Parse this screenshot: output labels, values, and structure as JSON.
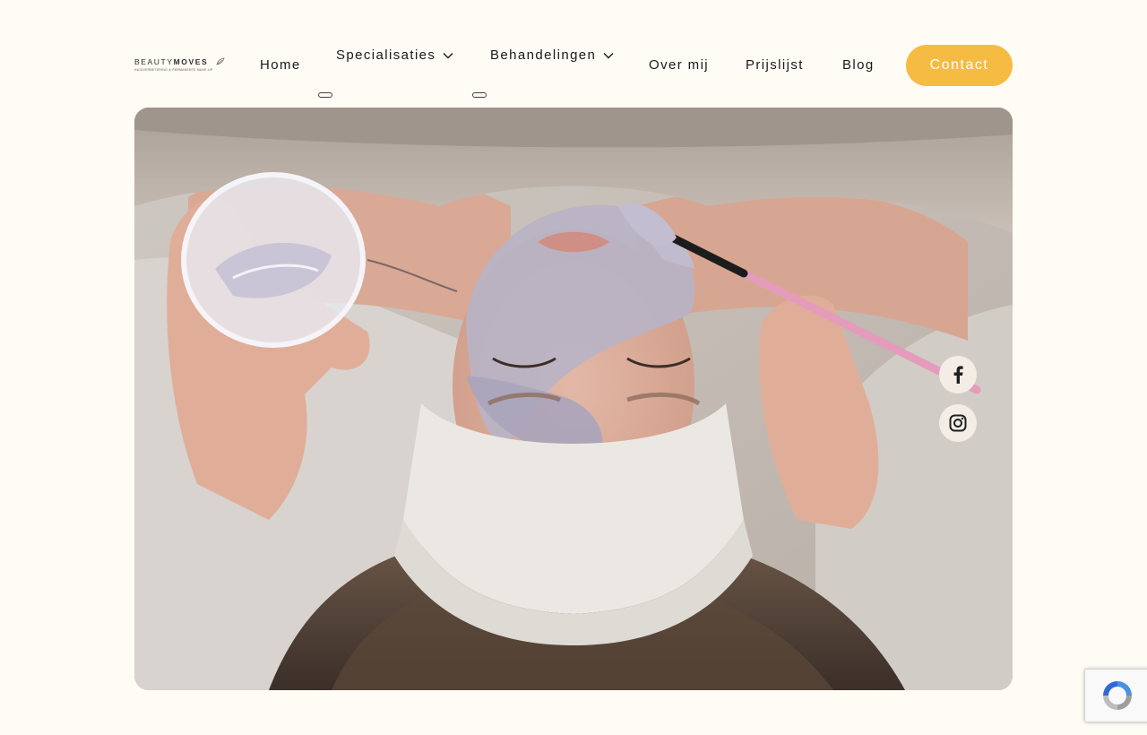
{
  "brand": {
    "name_light": "BEAUTY",
    "name_bold": "MOVES",
    "tagline": "HUIDVERBETERING & PERMANENTE MAKE-UP"
  },
  "nav": {
    "items": [
      {
        "label": "Home"
      },
      {
        "label": "Specialisaties",
        "has_submenu": true
      },
      {
        "label": "Behandelingen",
        "has_submenu": true
      },
      {
        "label": "Over mij"
      },
      {
        "label": "Prijslijst"
      },
      {
        "label": "Blog"
      }
    ],
    "cta_label": "Contact"
  },
  "social": [
    {
      "icon": "facebook-icon"
    },
    {
      "icon": "instagram-icon"
    }
  ],
  "recaptcha": {
    "icon": "recaptcha-icon"
  },
  "colors": {
    "page_bg": "#fffcf6",
    "accent": "#f6bb42",
    "social_bg": "#f3ede6"
  }
}
